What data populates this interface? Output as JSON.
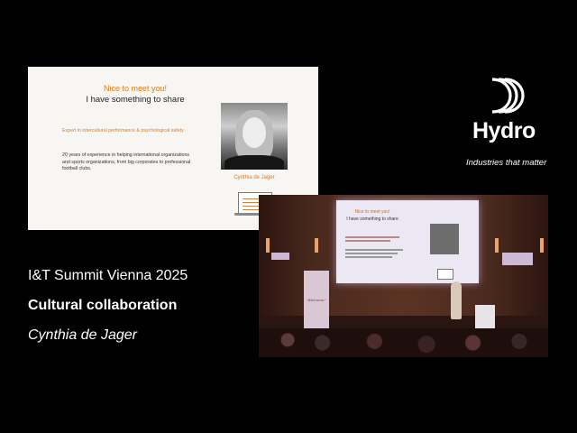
{
  "slide": {
    "greeting": "Nice to meet you!",
    "subtitle": "I have something to share",
    "expertise": "Expert in intercultural performance & psychological safety",
    "experience": "20 years of experience in helping international organizations and sports organizations, from big corporates to professional football clubs.",
    "caption": "Cynthia de Jager"
  },
  "brand": {
    "name": "Hydro",
    "tagline": "Industries that matter"
  },
  "event": {
    "title": "I&T Summit Vienna 2025",
    "talk": "Cultural collaboration",
    "speaker": "Cynthia de Jager"
  },
  "stage": {
    "screen_greeting": "Nice to meet you!",
    "screen_subtitle": "I have something to share",
    "banner_text": "Welcome!"
  },
  "colors": {
    "accent_orange": "#e07b1a",
    "background": "#000000",
    "slide_bg": "#f7f6f3"
  }
}
